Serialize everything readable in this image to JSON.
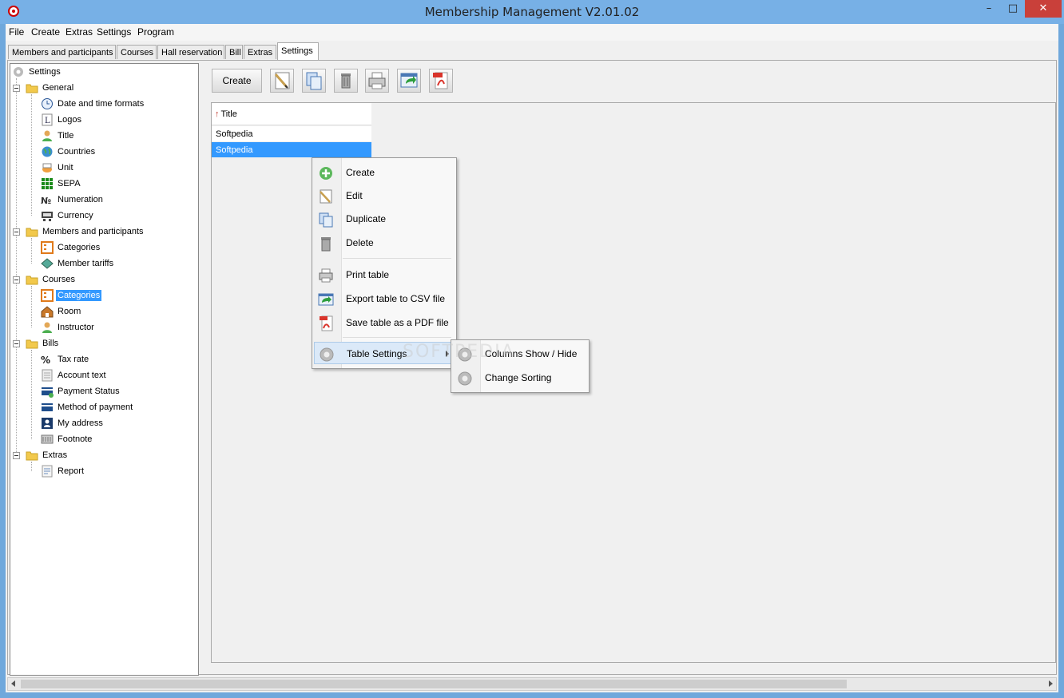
{
  "window": {
    "title": "Membership Management V2.01.02",
    "minimize_glyph": "–",
    "maximize_glyph": "□",
    "close_glyph": "✕"
  },
  "menubar": [
    "File",
    "Create",
    "Extras",
    "Settings",
    "Program"
  ],
  "tabs": [
    "Members and participants",
    "Courses",
    "Hall reservation",
    "Bill",
    "Extras",
    "Settings"
  ],
  "tree": {
    "root": "Settings",
    "groups": [
      {
        "label": "General",
        "items": [
          "Date and time formats",
          "Logos",
          "Title",
          "Countries",
          "Unit",
          "SEPA",
          "Numeration",
          "Currency"
        ]
      },
      {
        "label": "Members and participants",
        "items": [
          "Categories",
          "Member tariffs"
        ]
      },
      {
        "label": "Courses",
        "items": [
          "Categories",
          "Room",
          "Instructor"
        ]
      },
      {
        "label": "Bills",
        "items": [
          "Tax rate",
          "Account text",
          "Payment Status",
          "Method of payment",
          "My address",
          "Footnote"
        ]
      },
      {
        "label": "Extras",
        "items": [
          "Report"
        ]
      }
    ],
    "selected": "Courses > Categories"
  },
  "toolbar": {
    "create_label": "Create",
    "icons": [
      "edit-icon",
      "duplicate-icon",
      "delete-icon",
      "print-icon",
      "export-csv-icon",
      "pdf-icon"
    ]
  },
  "table": {
    "column_header": "Title",
    "sort_glyph": "↑",
    "rows": [
      "Softpedia",
      "Softpedia"
    ],
    "selected_row": 1
  },
  "context_menu": {
    "items": [
      "Create",
      "Edit",
      "Duplicate",
      "Delete",
      "Print table",
      "Export table to CSV file",
      "Save table as a PDF file",
      "Table Settings"
    ]
  },
  "submenu": {
    "items": [
      "Columns Show / Hide",
      "Change Sorting"
    ]
  },
  "watermark": "SOFTPEDIA",
  "colors": {
    "selection": "#3399ff",
    "title_bar": "#77b0e6",
    "close_button": "#c9403a"
  }
}
